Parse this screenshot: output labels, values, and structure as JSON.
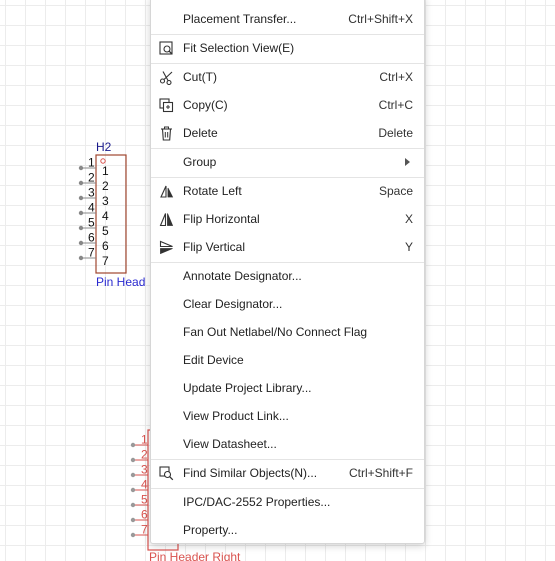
{
  "components": {
    "h2": {
      "designator": "H2",
      "name_partial": "Pin Head",
      "outer_pins": [
        "1",
        "2",
        "3",
        "4",
        "5",
        "6",
        "7"
      ],
      "inner_pins": [
        "1",
        "2",
        "3",
        "4",
        "5",
        "6",
        "7"
      ]
    },
    "lower": {
      "name_partial": "Pin Header Right",
      "outer_pins": [
        "1",
        "2",
        "3",
        "4",
        "5",
        "6",
        "7"
      ]
    }
  },
  "menu": {
    "placement_transfer": {
      "label": "Placement Transfer...",
      "shortcut": "Ctrl+Shift+X"
    },
    "fit_selection": {
      "label": "Fit Selection View(E)",
      "icon": "fit-selection-icon"
    },
    "cut": {
      "label": "Cut(T)",
      "shortcut": "Ctrl+X",
      "icon": "scissors-icon"
    },
    "copy": {
      "label": "Copy(C)",
      "shortcut": "Ctrl+C",
      "icon": "copy-icon"
    },
    "delete": {
      "label": "Delete",
      "shortcut": "Delete",
      "icon": "trash-icon"
    },
    "group": {
      "label": "Group"
    },
    "rotate_left": {
      "label": "Rotate Left",
      "shortcut": "Space",
      "icon": "rotate-left-icon"
    },
    "flip_horizontal": {
      "label": "Flip Horizontal",
      "shortcut": "X",
      "icon": "flip-horizontal-icon"
    },
    "flip_vertical": {
      "label": "Flip Vertical",
      "shortcut": "Y",
      "icon": "flip-vertical-icon"
    },
    "annotate_designator": {
      "label": "Annotate Designator..."
    },
    "clear_designator": {
      "label": "Clear Designator..."
    },
    "fan_out": {
      "label": "Fan Out Netlabel/No Connect Flag"
    },
    "edit_device": {
      "label": "Edit Device"
    },
    "update_project_library": {
      "label": "Update Project Library..."
    },
    "view_product_link": {
      "label": "View Product Link..."
    },
    "view_datasheet": {
      "label": "View Datasheet..."
    },
    "find_similar": {
      "label": "Find Similar Objects(N)...",
      "shortcut": "Ctrl+Shift+F",
      "icon": "find-similar-icon"
    },
    "ipc_properties": {
      "label": "IPC/DAC-2552 Properties..."
    },
    "property": {
      "label": "Property..."
    }
  },
  "colors": {
    "component_outline": "#a0462f",
    "designator_text": "#1a1a8c",
    "component_name": "#2a2ad0",
    "pin_line": "#888888",
    "lower_part": "#d9534f"
  }
}
